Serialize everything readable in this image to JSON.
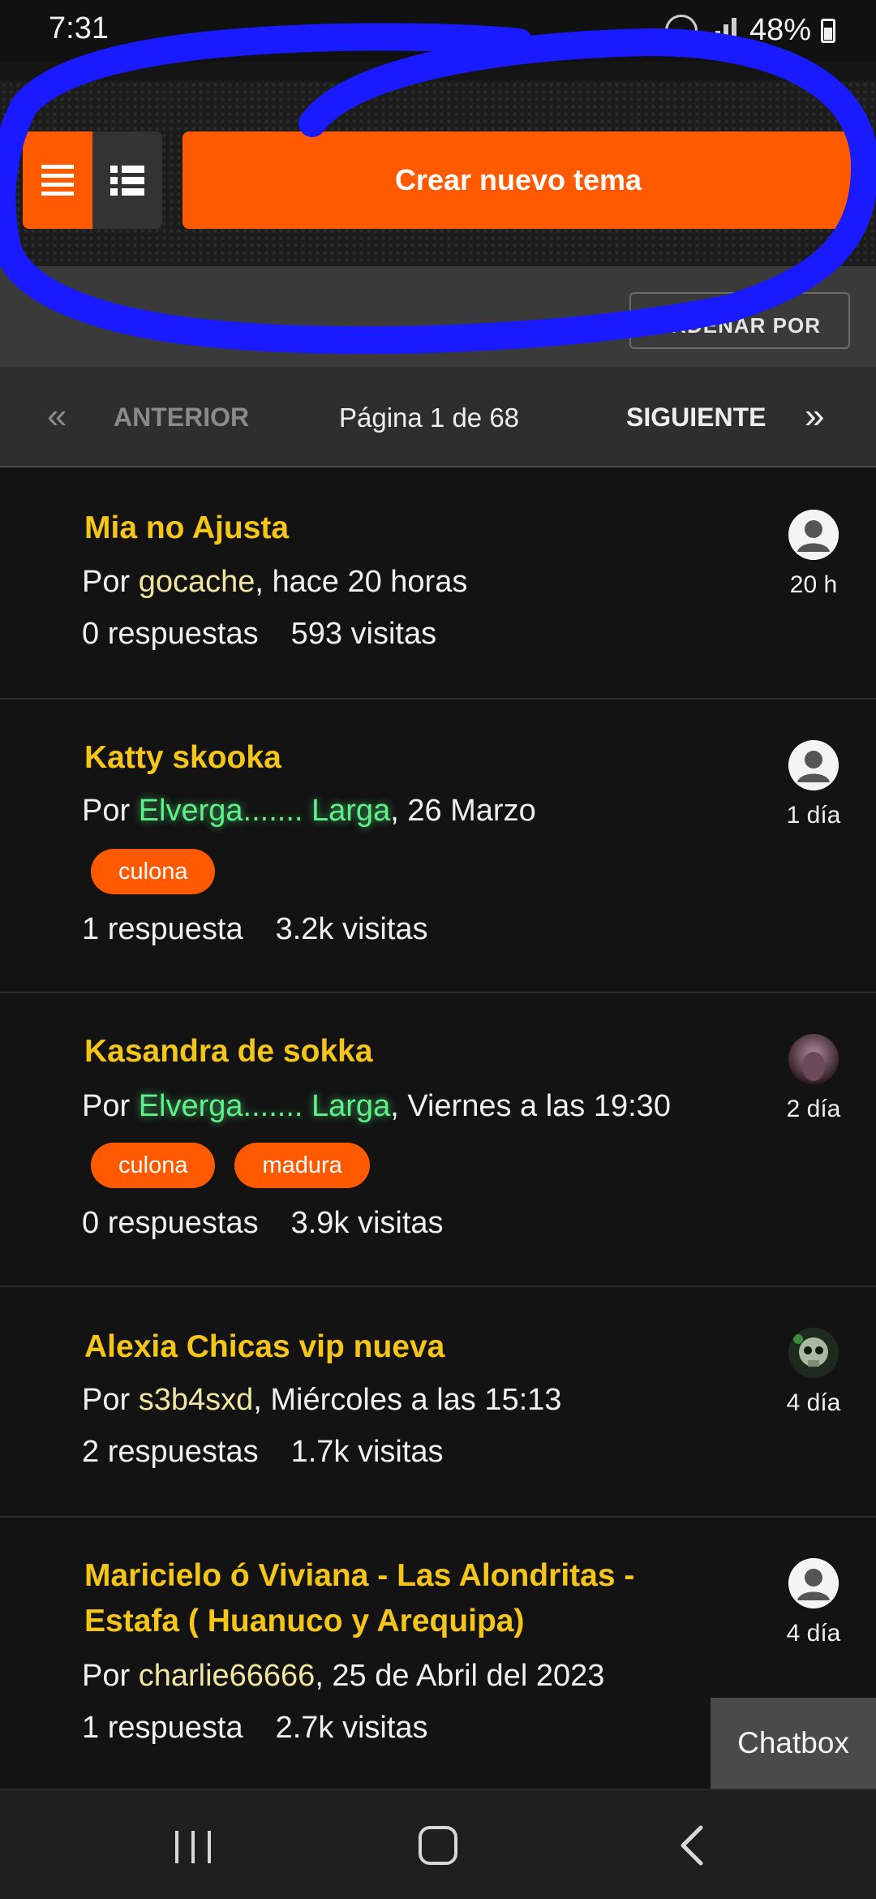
{
  "status_bar": {
    "time": "7:31",
    "battery": "48%"
  },
  "toolbar": {
    "create_label": "Crear nuevo tema",
    "sort_label": "ORDENAR POR"
  },
  "pagination": {
    "prev_label": "ANTERIOR",
    "page_info": "Página 1 de 68",
    "next_label": "SIGUIENTE"
  },
  "topics": [
    {
      "title": "Mia no Ajusta",
      "by": "Por ",
      "author": "gocache",
      "when": ", hace 20 horas",
      "tags": [],
      "replies": "0 respuestas",
      "views": "593 visitas",
      "age": "20 h",
      "avatar": "default-avatar"
    },
    {
      "title": "Katty skooka",
      "by": "Por ",
      "author": "Elverga....... Larga",
      "when": ", 26 Marzo",
      "tags": [
        "culona"
      ],
      "replies": "1 respuesta",
      "views": "3.2k visitas",
      "age": "1 día",
      "avatar": "default-avatar"
    },
    {
      "title": "Kasandra de sokka",
      "by": "Por ",
      "author": "Elverga....... Larga",
      "when": ", Viernes a las 19:30",
      "tags": [
        "culona",
        "madura"
      ],
      "replies": "0 respuestas",
      "views": "3.9k visitas",
      "age": "2 día",
      "avatar": "photo-avatar"
    },
    {
      "title": "Alexia Chicas vip nueva",
      "by": "Por ",
      "author": "s3b4sxd",
      "when": ", Miércoles a las 15:13",
      "tags": [],
      "replies": "2 respuestas",
      "views": "1.7k visitas",
      "age": "4 día",
      "avatar": "skull-avatar"
    },
    {
      "title_line1": "Maricielo ó Viviana - Las Alondritas -",
      "title_line2": "Estafa ( Huanuco y Arequipa)",
      "by": "Por ",
      "author": "charlie66666",
      "when": ", 25 de Abril del 2023",
      "tags": [],
      "replies": "1 respuesta",
      "views": "2.7k visitas",
      "age": "4 día",
      "avatar": "default-avatar"
    }
  ],
  "chatbox": {
    "label": "Chatbox"
  },
  "colors": {
    "accent": "#ff5a00",
    "title": "#f5c518",
    "annotation": "#1a1aff",
    "highlight_author": "#5ef08a"
  }
}
